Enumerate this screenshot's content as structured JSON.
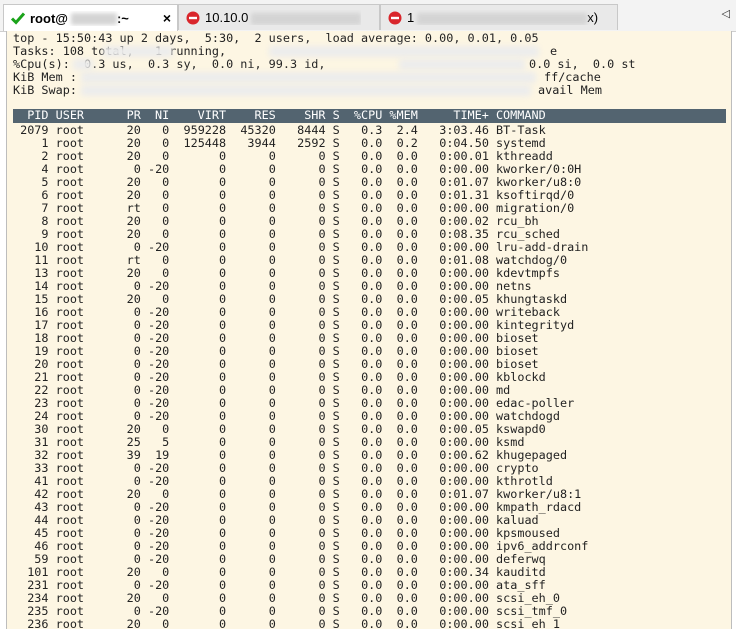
{
  "tabs": [
    {
      "label": "root@",
      "suffix": ":~",
      "status": "connected",
      "status_icon": "check-icon",
      "status_color": "#1aa31a",
      "closable": true
    },
    {
      "label": "10.10.0",
      "suffix": "",
      "status": "disconnected",
      "status_icon": "no-entry-icon",
      "status_color": "#d9262c",
      "closable": false
    },
    {
      "label": "1",
      "suffix": "x)",
      "status": "disconnected",
      "status_icon": "no-entry-icon",
      "status_color": "#d9262c",
      "closable": false
    }
  ],
  "close_glyph": "×",
  "scroll_arrow": "◁",
  "summary": {
    "line1": "top - 15:50:43 up 2 days,  5:30,  2 users,  load average: 0.00, 0.01, 0.05",
    "line2": "Tasks: 108 total,   1 running,",
    "line2_end": "e",
    "line3": "%Cpu(s):  0.3 us,  0.3 sy,  0.0 ni, 99.3 id,",
    "line3_end": "0.0 si,  0.0 st",
    "line4": "KiB Mem :",
    "line4_end": "ff/cache",
    "line5": "KiB Swap:",
    "line5_end": "avail Mem"
  },
  "columns": [
    "PID",
    "USER",
    "PR",
    "NI",
    "VIRT",
    "RES",
    "SHR",
    "S",
    "%CPU",
    "%MEM",
    "TIME+",
    "COMMAND"
  ],
  "processes": [
    {
      "pid": "2079",
      "user": "root",
      "pr": "20",
      "ni": "0",
      "virt": "959228",
      "res": "45320",
      "shr": "8444",
      "s": "S",
      "cpu": "0.3",
      "mem": "2.4",
      "time": "3:03.46",
      "cmd": "BT-Task"
    },
    {
      "pid": "1",
      "user": "root",
      "pr": "20",
      "ni": "0",
      "virt": "125448",
      "res": "3944",
      "shr": "2592",
      "s": "S",
      "cpu": "0.0",
      "mem": "0.2",
      "time": "0:04.50",
      "cmd": "systemd"
    },
    {
      "pid": "2",
      "user": "root",
      "pr": "20",
      "ni": "0",
      "virt": "0",
      "res": "0",
      "shr": "0",
      "s": "S",
      "cpu": "0.0",
      "mem": "0.0",
      "time": "0:00.01",
      "cmd": "kthreadd"
    },
    {
      "pid": "4",
      "user": "root",
      "pr": "0",
      "ni": "-20",
      "virt": "0",
      "res": "0",
      "shr": "0",
      "s": "S",
      "cpu": "0.0",
      "mem": "0.0",
      "time": "0:00.00",
      "cmd": "kworker/0:0H"
    },
    {
      "pid": "5",
      "user": "root",
      "pr": "20",
      "ni": "0",
      "virt": "0",
      "res": "0",
      "shr": "0",
      "s": "S",
      "cpu": "0.0",
      "mem": "0.0",
      "time": "0:01.07",
      "cmd": "kworker/u8:0"
    },
    {
      "pid": "6",
      "user": "root",
      "pr": "20",
      "ni": "0",
      "virt": "0",
      "res": "0",
      "shr": "0",
      "s": "S",
      "cpu": "0.0",
      "mem": "0.0",
      "time": "0:01.31",
      "cmd": "ksoftirqd/0"
    },
    {
      "pid": "7",
      "user": "root",
      "pr": "rt",
      "ni": "0",
      "virt": "0",
      "res": "0",
      "shr": "0",
      "s": "S",
      "cpu": "0.0",
      "mem": "0.0",
      "time": "0:00.00",
      "cmd": "migration/0"
    },
    {
      "pid": "8",
      "user": "root",
      "pr": "20",
      "ni": "0",
      "virt": "0",
      "res": "0",
      "shr": "0",
      "s": "S",
      "cpu": "0.0",
      "mem": "0.0",
      "time": "0:00.02",
      "cmd": "rcu_bh"
    },
    {
      "pid": "9",
      "user": "root",
      "pr": "20",
      "ni": "0",
      "virt": "0",
      "res": "0",
      "shr": "0",
      "s": "S",
      "cpu": "0.0",
      "mem": "0.0",
      "time": "0:08.35",
      "cmd": "rcu_sched"
    },
    {
      "pid": "10",
      "user": "root",
      "pr": "0",
      "ni": "-20",
      "virt": "0",
      "res": "0",
      "shr": "0",
      "s": "S",
      "cpu": "0.0",
      "mem": "0.0",
      "time": "0:00.00",
      "cmd": "lru-add-drain"
    },
    {
      "pid": "11",
      "user": "root",
      "pr": "rt",
      "ni": "0",
      "virt": "0",
      "res": "0",
      "shr": "0",
      "s": "S",
      "cpu": "0.0",
      "mem": "0.0",
      "time": "0:01.08",
      "cmd": "watchdog/0"
    },
    {
      "pid": "13",
      "user": "root",
      "pr": "20",
      "ni": "0",
      "virt": "0",
      "res": "0",
      "shr": "0",
      "s": "S",
      "cpu": "0.0",
      "mem": "0.0",
      "time": "0:00.00",
      "cmd": "kdevtmpfs"
    },
    {
      "pid": "14",
      "user": "root",
      "pr": "0",
      "ni": "-20",
      "virt": "0",
      "res": "0",
      "shr": "0",
      "s": "S",
      "cpu": "0.0",
      "mem": "0.0",
      "time": "0:00.00",
      "cmd": "netns"
    },
    {
      "pid": "15",
      "user": "root",
      "pr": "20",
      "ni": "0",
      "virt": "0",
      "res": "0",
      "shr": "0",
      "s": "S",
      "cpu": "0.0",
      "mem": "0.0",
      "time": "0:00.05",
      "cmd": "khungtaskd"
    },
    {
      "pid": "16",
      "user": "root",
      "pr": "0",
      "ni": "-20",
      "virt": "0",
      "res": "0",
      "shr": "0",
      "s": "S",
      "cpu": "0.0",
      "mem": "0.0",
      "time": "0:00.00",
      "cmd": "writeback"
    },
    {
      "pid": "17",
      "user": "root",
      "pr": "0",
      "ni": "-20",
      "virt": "0",
      "res": "0",
      "shr": "0",
      "s": "S",
      "cpu": "0.0",
      "mem": "0.0",
      "time": "0:00.00",
      "cmd": "kintegrityd"
    },
    {
      "pid": "18",
      "user": "root",
      "pr": "0",
      "ni": "-20",
      "virt": "0",
      "res": "0",
      "shr": "0",
      "s": "S",
      "cpu": "0.0",
      "mem": "0.0",
      "time": "0:00.00",
      "cmd": "bioset"
    },
    {
      "pid": "19",
      "user": "root",
      "pr": "0",
      "ni": "-20",
      "virt": "0",
      "res": "0",
      "shr": "0",
      "s": "S",
      "cpu": "0.0",
      "mem": "0.0",
      "time": "0:00.00",
      "cmd": "bioset"
    },
    {
      "pid": "20",
      "user": "root",
      "pr": "0",
      "ni": "-20",
      "virt": "0",
      "res": "0",
      "shr": "0",
      "s": "S",
      "cpu": "0.0",
      "mem": "0.0",
      "time": "0:00.00",
      "cmd": "bioset"
    },
    {
      "pid": "21",
      "user": "root",
      "pr": "0",
      "ni": "-20",
      "virt": "0",
      "res": "0",
      "shr": "0",
      "s": "S",
      "cpu": "0.0",
      "mem": "0.0",
      "time": "0:00.00",
      "cmd": "kblockd"
    },
    {
      "pid": "22",
      "user": "root",
      "pr": "0",
      "ni": "-20",
      "virt": "0",
      "res": "0",
      "shr": "0",
      "s": "S",
      "cpu": "0.0",
      "mem": "0.0",
      "time": "0:00.00",
      "cmd": "md"
    },
    {
      "pid": "23",
      "user": "root",
      "pr": "0",
      "ni": "-20",
      "virt": "0",
      "res": "0",
      "shr": "0",
      "s": "S",
      "cpu": "0.0",
      "mem": "0.0",
      "time": "0:00.00",
      "cmd": "edac-poller"
    },
    {
      "pid": "24",
      "user": "root",
      "pr": "0",
      "ni": "-20",
      "virt": "0",
      "res": "0",
      "shr": "0",
      "s": "S",
      "cpu": "0.0",
      "mem": "0.0",
      "time": "0:00.00",
      "cmd": "watchdogd"
    },
    {
      "pid": "30",
      "user": "root",
      "pr": "20",
      "ni": "0",
      "virt": "0",
      "res": "0",
      "shr": "0",
      "s": "S",
      "cpu": "0.0",
      "mem": "0.0",
      "time": "0:00.05",
      "cmd": "kswapd0"
    },
    {
      "pid": "31",
      "user": "root",
      "pr": "25",
      "ni": "5",
      "virt": "0",
      "res": "0",
      "shr": "0",
      "s": "S",
      "cpu": "0.0",
      "mem": "0.0",
      "time": "0:00.00",
      "cmd": "ksmd"
    },
    {
      "pid": "32",
      "user": "root",
      "pr": "39",
      "ni": "19",
      "virt": "0",
      "res": "0",
      "shr": "0",
      "s": "S",
      "cpu": "0.0",
      "mem": "0.0",
      "time": "0:00.62",
      "cmd": "khugepaged"
    },
    {
      "pid": "33",
      "user": "root",
      "pr": "0",
      "ni": "-20",
      "virt": "0",
      "res": "0",
      "shr": "0",
      "s": "S",
      "cpu": "0.0",
      "mem": "0.0",
      "time": "0:00.00",
      "cmd": "crypto"
    },
    {
      "pid": "41",
      "user": "root",
      "pr": "0",
      "ni": "-20",
      "virt": "0",
      "res": "0",
      "shr": "0",
      "s": "S",
      "cpu": "0.0",
      "mem": "0.0",
      "time": "0:00.00",
      "cmd": "kthrotld"
    },
    {
      "pid": "42",
      "user": "root",
      "pr": "20",
      "ni": "0",
      "virt": "0",
      "res": "0",
      "shr": "0",
      "s": "S",
      "cpu": "0.0",
      "mem": "0.0",
      "time": "0:01.07",
      "cmd": "kworker/u8:1"
    },
    {
      "pid": "43",
      "user": "root",
      "pr": "0",
      "ni": "-20",
      "virt": "0",
      "res": "0",
      "shr": "0",
      "s": "S",
      "cpu": "0.0",
      "mem": "0.0",
      "time": "0:00.00",
      "cmd": "kmpath_rdacd"
    },
    {
      "pid": "44",
      "user": "root",
      "pr": "0",
      "ni": "-20",
      "virt": "0",
      "res": "0",
      "shr": "0",
      "s": "S",
      "cpu": "0.0",
      "mem": "0.0",
      "time": "0:00.00",
      "cmd": "kaluad"
    },
    {
      "pid": "45",
      "user": "root",
      "pr": "0",
      "ni": "-20",
      "virt": "0",
      "res": "0",
      "shr": "0",
      "s": "S",
      "cpu": "0.0",
      "mem": "0.0",
      "time": "0:00.00",
      "cmd": "kpsmoused"
    },
    {
      "pid": "46",
      "user": "root",
      "pr": "0",
      "ni": "-20",
      "virt": "0",
      "res": "0",
      "shr": "0",
      "s": "S",
      "cpu": "0.0",
      "mem": "0.0",
      "time": "0:00.00",
      "cmd": "ipv6_addrconf"
    },
    {
      "pid": "59",
      "user": "root",
      "pr": "0",
      "ni": "-20",
      "virt": "0",
      "res": "0",
      "shr": "0",
      "s": "S",
      "cpu": "0.0",
      "mem": "0.0",
      "time": "0:00.00",
      "cmd": "deferwq"
    },
    {
      "pid": "101",
      "user": "root",
      "pr": "20",
      "ni": "0",
      "virt": "0",
      "res": "0",
      "shr": "0",
      "s": "S",
      "cpu": "0.0",
      "mem": "0.0",
      "time": "0:00.34",
      "cmd": "kauditd"
    },
    {
      "pid": "231",
      "user": "root",
      "pr": "0",
      "ni": "-20",
      "virt": "0",
      "res": "0",
      "shr": "0",
      "s": "S",
      "cpu": "0.0",
      "mem": "0.0",
      "time": "0:00.00",
      "cmd": "ata_sff"
    },
    {
      "pid": "234",
      "user": "root",
      "pr": "20",
      "ni": "0",
      "virt": "0",
      "res": "0",
      "shr": "0",
      "s": "S",
      "cpu": "0.0",
      "mem": "0.0",
      "time": "0:00.00",
      "cmd": "scsi_eh_0"
    },
    {
      "pid": "235",
      "user": "root",
      "pr": "0",
      "ni": "-20",
      "virt": "0",
      "res": "0",
      "shr": "0",
      "s": "S",
      "cpu": "0.0",
      "mem": "0.0",
      "time": "0:00.00",
      "cmd": "scsi_tmf_0"
    },
    {
      "pid": "236",
      "user": "root",
      "pr": "20",
      "ni": "0",
      "virt": "0",
      "res": "0",
      "shr": "0",
      "s": "S",
      "cpu": "0.0",
      "mem": "0.0",
      "time": "0:00.00",
      "cmd": "scsi_eh_1"
    }
  ]
}
